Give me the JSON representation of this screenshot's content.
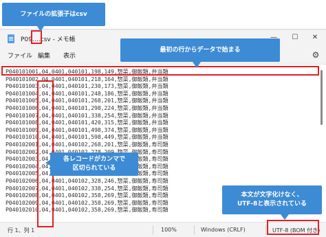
{
  "callouts": {
    "extension": "ファイルの拡張子はcsv",
    "first_line": "最初の行からデータで始まる",
    "comma": "各レコードがカンマで\n区切られている",
    "encoding": "本文が文字化けなく、\nUTF-8と表示されている"
  },
  "window": {
    "title": "P09….csv - メモ帳",
    "minimize": "—",
    "maximize": "☐",
    "close": "✕"
  },
  "menu": {
    "file": "ファイル",
    "edit": "編集",
    "view": "表示",
    "settings_icon": "gear-icon"
  },
  "lines": [
    "P040101001,04,0401,040101,198,149,惣菜,御飯類,弁当類",
    "P040101002,04,0401,040101,218,164,惣菜,御飯類,弁当類",
    "P040101003,04,0401,040101,230,173,惣菜,御飯類,弁当類",
    "P040101004,04,0401,040101,248,186,惣菜,御飯類,弁当類",
    "P040101005,04,0401,040101,268,201,惣菜,御飯類,弁当類",
    "P040101006,04,0401,040101,298,224,惣菜,御飯類,弁当類",
    "P040101007,04,0401,040101,338,254,惣菜,御飯類,弁当類",
    "P040101008,04,0401,040101,420,315,惣菜,御飯類,弁当類",
    "P040101009,04,0401,040101,498,374,惣菜,御飯類,弁当類",
    "P040101010,04,0401,040101,598,449,惣菜,御飯類,弁当類",
    "P040102001,04,0401,040102,268,201,惣菜,御飯類,寿司類",
    "P040102002,04,0401,040102,278,209,惣菜,御飯類,寿司類",
    "P040102003,04,0401,040102,288,216,惣菜,御飯類,寿司類",
    "P040102004,04,0401,040102,298,224,惣菜,御飯類,寿司類",
    "P040102005,04,0401,040102,318,239,惣菜,御飯類,寿司類",
    "P040102006,04,0401,040102,328,246,惣菜,御飯類,寿司類",
    "P040102007,04,0401,040102,338,254,惣菜,御飯類,寿司類",
    "P040102008,04,0401,040102,358,269,惣菜,御飯類,寿司類",
    "P040102009,04,0401,040102,358,269,惣菜,御飯類,寿司類",
    "P040102010,04,0401,040102,358,269,惣菜,御飯類,寿司類"
  ],
  "status": {
    "position": "行 1、列 1",
    "zoom": "100%",
    "eol": "Windows (CRLF)",
    "encoding": "UTF-8 (BOM 付き)"
  }
}
